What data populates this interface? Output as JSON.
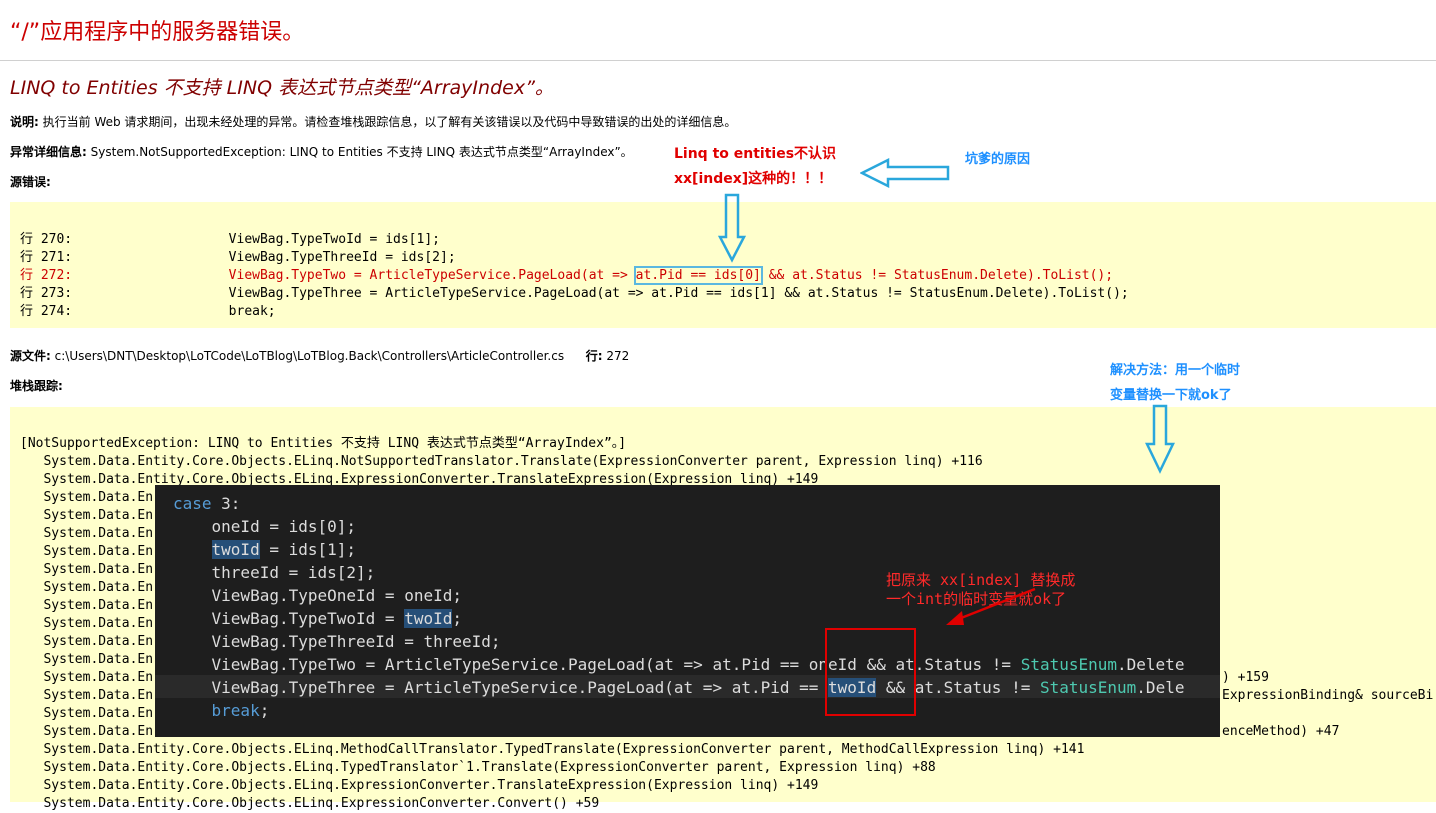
{
  "page": {
    "title": "“/”应用程序中的服务器错误。",
    "error_heading": "LINQ to Entities 不支持 LINQ 表达式节点类型“ArrayIndex”。",
    "desc_label": "说明:",
    "desc_text": "执行当前 Web 请求期间，出现未经处理的异常。请检查堆栈跟踪信息，以了解有关该错误以及代码中导致错误的出处的详细信息。",
    "exc_label": "异常详细信息:",
    "exc_text": "System.NotSupportedException: LINQ to Entities 不支持 LINQ 表达式节点类型“ArrayIndex”。",
    "source_error_label": "源错误:",
    "source_file_label": "源文件:",
    "source_file_path": "c:\\Users\\DNT\\Desktop\\LoTCode\\LoTBlog\\LoTBlog.Back\\Controllers\\ArticleController.cs",
    "line_label": "行:",
    "line_value": "272",
    "stack_label": "堆栈跟踪:"
  },
  "source_lines": [
    {
      "text": "行 270:                    ViewBag.TypeTwoId = ids[1];",
      "error": false
    },
    {
      "text": "行 271:                    ViewBag.TypeThreeId = ids[2];",
      "error": false
    },
    {
      "pre": "行 272:                    ViewBag.TypeTwo = ArticleTypeService.PageLoad(at => ",
      "box": "at.Pid == ids[0]",
      "post": " && at.Status != StatusEnum.Delete).ToList();",
      "error": true
    },
    {
      "text": "行 273:                    ViewBag.TypeThree = ArticleTypeService.PageLoad(at => at.Pid == ids[1] && at.Status != StatusEnum.Delete).ToList();",
      "error": false
    },
    {
      "text": "行 274:                    break;",
      "error": false
    }
  ],
  "stack": {
    "first": "[NotSupportedException: LINQ to Entities 不支持 LINQ 表达式节点类型“ArrayIndex”。]",
    "line1": "   System.Data.Entity.Core.Objects.ELinq.NotSupportedTranslator.Translate(ExpressionConverter parent, Expression linq) +116",
    "line2": "   System.Data.Entity.Core.Objects.ELinq.ExpressionConverter.TranslateExpression(Expression linq) +149",
    "prefix": "   System.Data.En",
    "tail_159": ") +159",
    "tail_binding": "ExpressionBinding& sourceBi",
    "tail_47": "enceMethod) +47",
    "line_b1": "   System.Data.Entity.Core.Objects.ELinq.MethodCallTranslator.TypedTranslate(ExpressionConverter parent, MethodCallExpression linq) +141",
    "line_b2": "   System.Data.Entity.Core.Objects.ELinq.TypedTranslator`1.Translate(ExpressionConverter parent, Expression linq) +88",
    "line_b3": "   System.Data.Entity.Core.Objects.ELinq.ExpressionConverter.TranslateExpression(Expression linq) +149",
    "line_b4": "   System.Data.Entity.Core.Objects.ELinq.ExpressionConverter.Convert() +59"
  },
  "editor": {
    "l1_kw": "case",
    "l1_rest": " 3:",
    "l2": "    oneId = ids[0];",
    "l3_hl": "twoId",
    "l3_rest": " = ids[1];",
    "l4": "    threeId = ids[2];",
    "l5": "    ViewBag.TypeOneId = oneId;",
    "l6_pre": "    ViewBag.TypeTwoId = ",
    "l6_hl": "twoId",
    "l6_post": ";",
    "l7": "    ViewBag.TypeThreeId = threeId;",
    "l8_pre": "    ViewBag.TypeTwo = ArticleTypeService.PageLoad(at => at.Pid == oneId && at.Status != ",
    "l8_enum": "StatusEnum",
    "l8_post": ".Delete",
    "l9_pre": "    ViewBag.TypeThree = ArticleTypeService.PageLoad(at => at.Pid == ",
    "l9_hl": "twoId",
    "l9_mid": " && at.Status != ",
    "l9_enum": "StatusEnum",
    "l9_post": ".Dele",
    "l10_kw": "break",
    "l10_rest": ";"
  },
  "annotations": {
    "red1_line1": "Linq to entities不认识",
    "red1_line2": "xx[index]这种的！！！",
    "blue1": "坑爹的原因",
    "blue2_line1": "解决方法：用一个临时",
    "blue2_line2": "变量替换一下就ok了",
    "red2_line1": "把原来 xx[index] 替换成",
    "red2_line2": "一个int的临时变量就ok了"
  },
  "colors": {
    "title_red": "#cc0000",
    "heading_maroon": "#800000",
    "code_bg": "#ffffcc",
    "annotation_red": "#e00000",
    "annotation_blue": "#1e90ff",
    "editor_bg": "#1e1e1e"
  }
}
